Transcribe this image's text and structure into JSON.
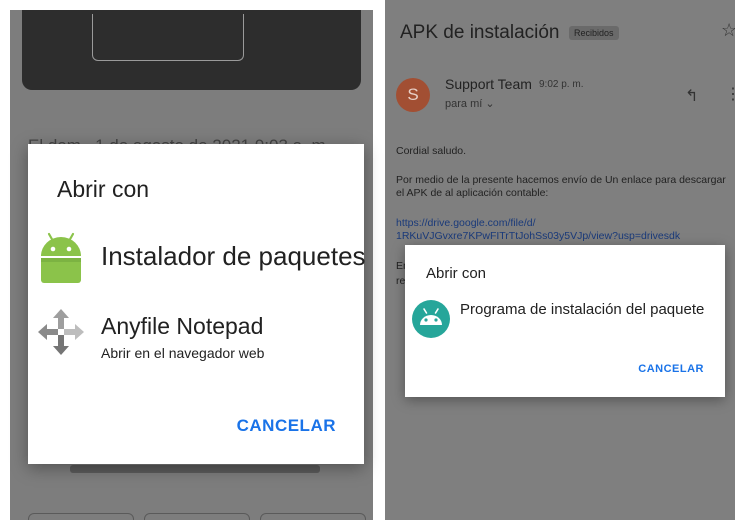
{
  "left": {
    "background_text": "El dom., 1 de agosto de 2021 9:03 a. m.",
    "dialog": {
      "title": "Abrir con",
      "options": [
        {
          "label": "Instalador de paquetes",
          "icon": "android-icon"
        },
        {
          "label": "Anyfile Notepad",
          "sublabel": "Abrir en el navegador web",
          "icon": "move-arrows-icon"
        }
      ],
      "cancel_label": "CANCELAR"
    }
  },
  "right": {
    "subject": "APK de instalación",
    "badge": "Recibidos",
    "sender": {
      "initial": "S",
      "name": "Support Team",
      "time": "9:02 p. m.",
      "to": "para mí ⌄"
    },
    "body": {
      "greeting": "Cordial saludo.",
      "paragraph": "Por medio de la presente hacemos envío de Un enlace para descargar el APK de al aplicación contable:",
      "link_line1": "https://drive.google.com/file/d/",
      "link_line2": "1RKuVJGvxre7KPwFITrTtJohSs03y5VJp/view?usp=drivesdk",
      "frag1": "En",
      "frag2": "re"
    },
    "dialog": {
      "title": "Abrir con",
      "option_label": "Programa de instalación del paquete",
      "icon": "android-icon",
      "cancel_label": "CANCELAR"
    }
  },
  "colors": {
    "accent": "#1a73e8",
    "android_green": "#8bc34a",
    "installer_teal": "#26a69a",
    "scrim": "#7d7d7d"
  }
}
